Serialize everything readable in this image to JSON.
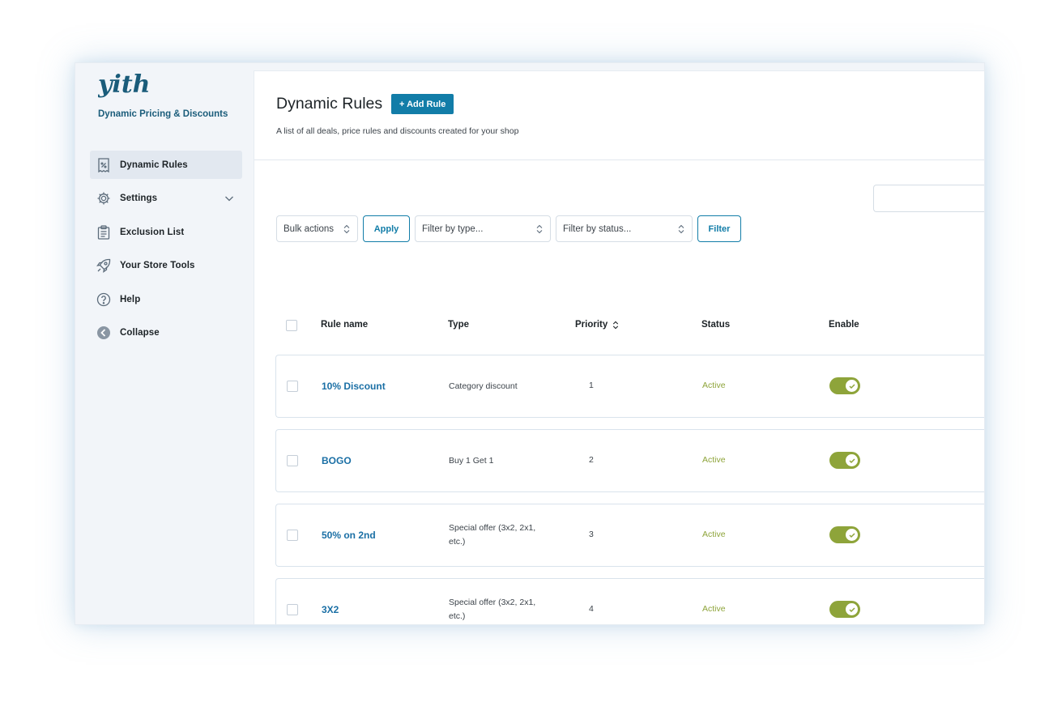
{
  "sidebar": {
    "logo_text": "yith",
    "plugin_name": "Dynamic Pricing & Discounts",
    "items": [
      {
        "label": "Dynamic Rules",
        "icon": "receipt-icon",
        "active": true
      },
      {
        "label": "Settings",
        "icon": "gear-icon",
        "active": false
      },
      {
        "label": "Exclusion List",
        "icon": "clipboard-list-icon",
        "active": false
      },
      {
        "label": "Your Store Tools",
        "icon": "rocket-icon",
        "active": false
      },
      {
        "label": "Help",
        "icon": "question-circle-icon",
        "active": false
      },
      {
        "label": "Collapse",
        "icon": "collapse-arrow-icon",
        "active": false
      }
    ]
  },
  "header": {
    "title": "Dynamic Rules",
    "add_rule_label": "+ Add Rule",
    "subtitle": "A list of all deals, price rules and discounts created for your shop"
  },
  "search": {
    "placeholder": ""
  },
  "toolbar": {
    "bulk_actions": "Bulk actions",
    "apply_label": "Apply",
    "filter_type": "Filter by type...",
    "filter_status": "Filter by status...",
    "filter_label": "Filter"
  },
  "table": {
    "headers": {
      "rule_name": "Rule name",
      "type": "Type",
      "priority": "Priority",
      "status": "Status",
      "enable": "Enable"
    },
    "rows": [
      {
        "name": "10% Discount",
        "type": "Category discount",
        "priority": "1",
        "status": "Active",
        "enabled": true
      },
      {
        "name": "BOGO",
        "type": "Buy 1 Get 1",
        "priority": "2",
        "status": "Active",
        "enabled": true
      },
      {
        "name": "50% on 2nd",
        "type": "Special offer (3x2, 2x1, etc.)",
        "priority": "3",
        "status": "Active",
        "enabled": true
      },
      {
        "name": "3X2",
        "type": "Special offer (3x2, 2x1, etc.)",
        "priority": "4",
        "status": "Active",
        "enabled": true
      }
    ]
  },
  "colors": {
    "accent": "#127da8",
    "link": "#1a6fa5",
    "active_status": "#8ea43a",
    "sidebar_bg": "#f2f5f9"
  }
}
